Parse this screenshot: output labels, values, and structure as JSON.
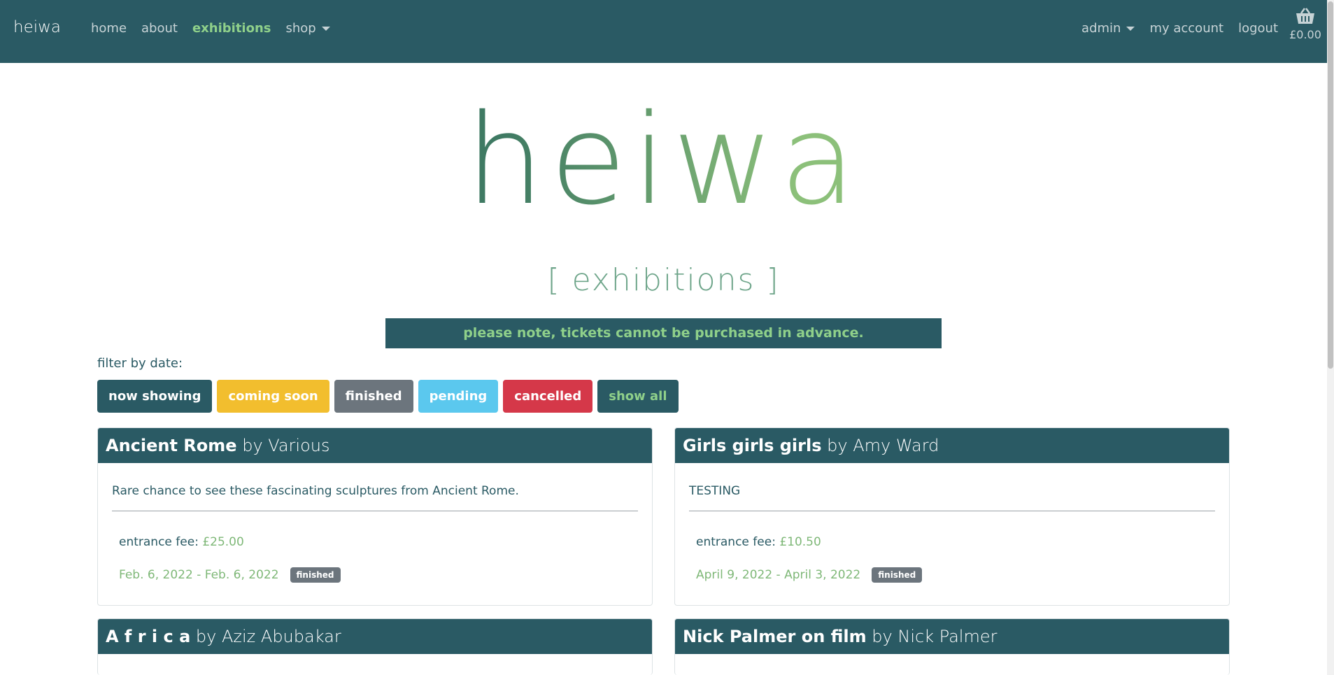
{
  "nav": {
    "brand": "heiwa",
    "links": [
      "home",
      "about",
      "exhibitions",
      "shop"
    ],
    "right_links": [
      "admin",
      "my account",
      "logout"
    ],
    "basket_total": "£0.00"
  },
  "hero": {
    "logo": "heiwa",
    "subtitle": "[ exhibitions ]"
  },
  "notice": "please note, tickets cannot be purchased in advance.",
  "filter": {
    "label": "filter by date:",
    "buttons": [
      "now showing",
      "coming soon",
      "finished",
      "pending",
      "cancelled",
      "show all"
    ]
  },
  "exhibitions": [
    {
      "title": "Ancient Rome",
      "by": "by Various",
      "description": "Rare chance to see these fascinating sculptures from Ancient Rome.",
      "fee_label": "entrance fee:",
      "fee": "£25.00",
      "dates": "Feb. 6, 2022 - Feb. 6, 2022",
      "status": "finished"
    },
    {
      "title": "Girls girls girls",
      "by": "by Amy Ward",
      "description": "TESTING",
      "fee_label": "entrance fee:",
      "fee": "£10.50",
      "dates": "April 9, 2022 - April 3, 2022",
      "status": "finished"
    },
    {
      "title": "A f r i c a",
      "by": "by Aziz Abubakar"
    },
    {
      "title": "Nick Palmer on film",
      "by": "by Nick Palmer"
    }
  ],
  "colors": {
    "primary": "#2a5a64",
    "accent_green": "#8fd08a",
    "warning": "#f2be2e",
    "secondary": "#6c757d",
    "info": "#5bc8ee",
    "danger": "#d53849"
  },
  "icons": {
    "basket": "basket-icon",
    "caret": "caret-down-icon"
  }
}
